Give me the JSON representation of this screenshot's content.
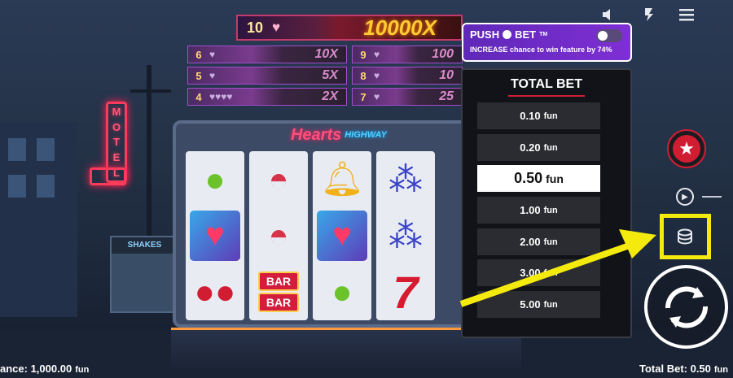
{
  "paytable": {
    "top": {
      "count": "10",
      "multiplier": "10000X"
    },
    "rows": [
      {
        "count": "6",
        "multiplier": "10X",
        "hearts": "♥"
      },
      {
        "count": "5",
        "multiplier": "5X",
        "hearts": "♥"
      },
      {
        "count": "4",
        "multiplier": "2X",
        "hearts": "♥♥♥♥"
      },
      {
        "count": "9",
        "multiplier": "100",
        "hearts": "♥"
      },
      {
        "count": "8",
        "multiplier": "10",
        "hearts": "♥"
      },
      {
        "count": "7",
        "multiplier": "25",
        "hearts": "♥"
      }
    ]
  },
  "scene": {
    "motel_letters": [
      "M",
      "O",
      "T",
      "E",
      "L"
    ],
    "shop_sign": "SHAKES"
  },
  "machine": {
    "logo_title": "Hearts",
    "logo_subtitle": "HIGHWAY",
    "reels": [
      [
        "lime",
        "heart",
        "cherry"
      ],
      [
        "melon",
        "melon",
        "bar"
      ],
      [
        "bell",
        "heart",
        "lime"
      ],
      [
        "grape",
        "grape",
        "seven"
      ]
    ],
    "bar_label": "BAR"
  },
  "push_bet": {
    "brand": "PUSH",
    "brand_suffix": "BET",
    "tm": "TM",
    "description": "INCREASE chance to win feature by 74%",
    "enabled": false
  },
  "total_bet_panel": {
    "title": "TOTAL BET",
    "unit": "fun",
    "options": [
      "0.10",
      "0.20",
      "0.50",
      "1.00",
      "2.00",
      "3.00",
      "5.00"
    ],
    "selected_index": 2
  },
  "status": {
    "balance_label": "ance: 1,000.00",
    "balance_unit": "fun",
    "total_bet_label": "Total Bet: 0.50",
    "total_bet_unit": "fun"
  },
  "colors": {
    "accent_red": "#d11d32",
    "highlight_yellow": "#f5ea0d",
    "push_bet_purple": "#7f2fd4"
  },
  "icons": [
    "sound-icon",
    "turbo-icon",
    "menu-icon",
    "favorite-star-icon",
    "autoplay-icon",
    "coins-icon",
    "spin-icon"
  ]
}
